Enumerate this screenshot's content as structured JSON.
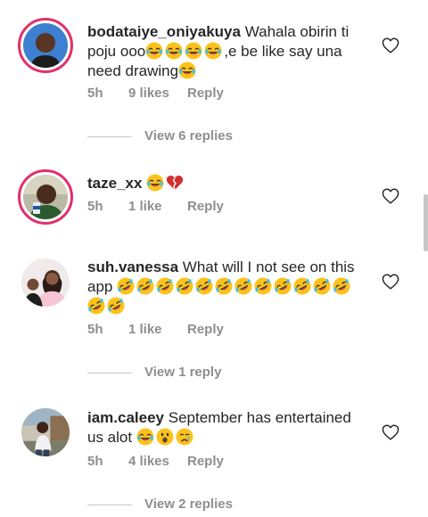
{
  "comments": [
    {
      "username": "bodataiye_oniyakuya",
      "text": "Wahala obirin ti poju ooo",
      "text_suffix": ",e be like say una need drawing",
      "time": "5h",
      "likes": "9 likes",
      "reply": "Reply",
      "view_replies": "View 6 replies",
      "emoji_1": "😂😂😂😂",
      "emoji_2": "😂"
    },
    {
      "username": "taze_xx",
      "text": "",
      "emoji": "😂💔",
      "time": "5h",
      "likes": "1 like",
      "reply": "Reply"
    },
    {
      "username": "suh.vanessa",
      "text": "What will I not see on this app",
      "emoji": "🤣🤣🤣🤣🤣🤣🤣🤣🤣🤣🤣🤣🤣🤣",
      "time": "5h",
      "likes": "1 like",
      "reply": "Reply",
      "view_replies": "View 1 reply"
    },
    {
      "username": "iam.caleey",
      "text": "September  has entertained us alot",
      "emoji": "😂😮😢",
      "time": "5h",
      "likes": "4 likes",
      "reply": "Reply",
      "view_replies": "View 2 replies"
    }
  ],
  "icons": {
    "like": "heart-outline-icon",
    "laugh": "face-with-tears-of-joy-emoji",
    "rofl": "rolling-on-the-floor-laughing-emoji",
    "broken_heart": "broken-heart-emoji",
    "surprised": "face-with-open-mouth-emoji",
    "crying": "crying-face-emoji"
  },
  "colors": {
    "story_ring": "#e1306c",
    "meta_text": "#8e8e8e",
    "primary_text": "#262626"
  }
}
